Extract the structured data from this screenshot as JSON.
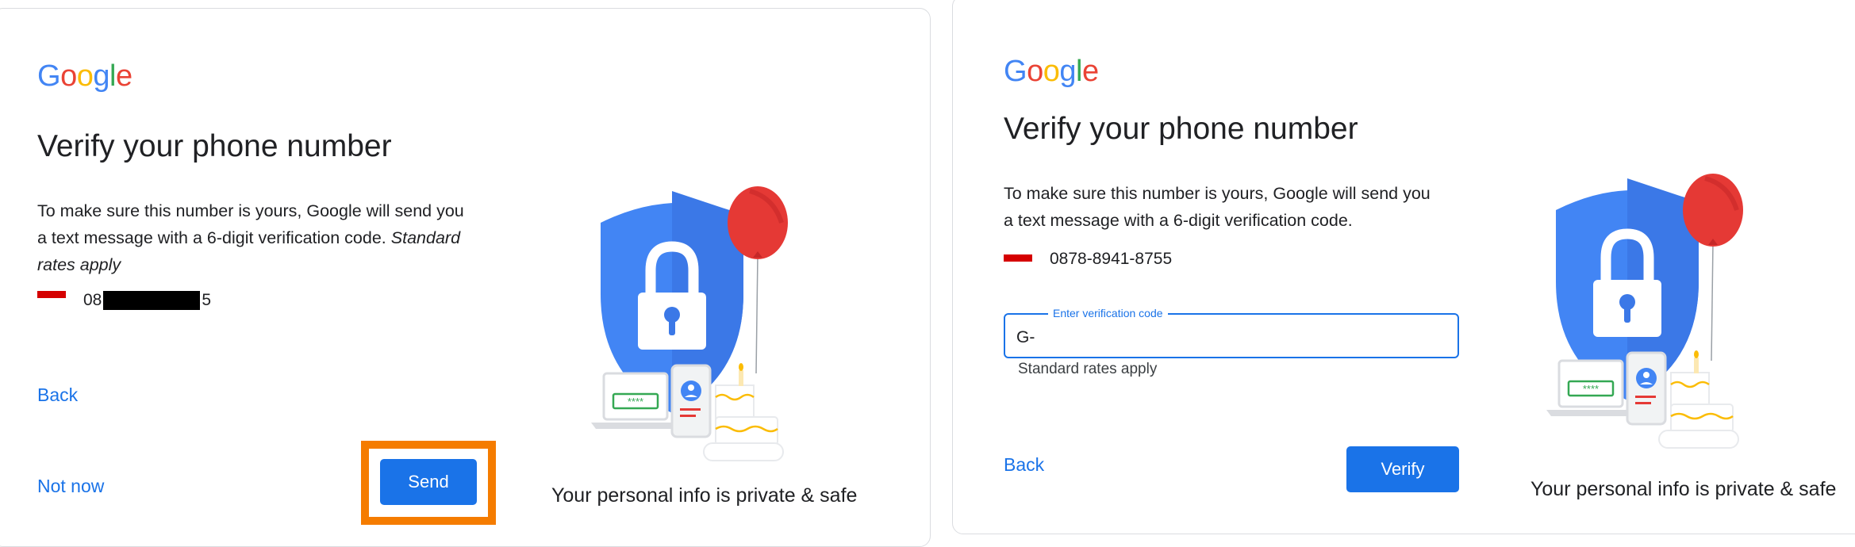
{
  "logo": {
    "letters": [
      {
        "char": "G",
        "color": "#4285F4"
      },
      {
        "char": "o",
        "color": "#EA4335"
      },
      {
        "char": "o",
        "color": "#FBBC05"
      },
      {
        "char": "g",
        "color": "#4285F4"
      },
      {
        "char": "l",
        "color": "#34A853"
      },
      {
        "char": "e",
        "color": "#EA4335"
      }
    ]
  },
  "left": {
    "title": "Verify your phone number",
    "description_line1": "To make sure this number is yours, Google will send you",
    "description_line2": "a text message with a 6-digit verification code.",
    "description_italic_a": "Standard",
    "description_italic_b": "rates apply",
    "phone_prefix": "08",
    "phone_suffix": "5",
    "back_label": "Back",
    "not_now_label": "Not now",
    "send_label": "Send",
    "privacy_text": "Your personal info is private & safe"
  },
  "right": {
    "title": "Verify your phone number",
    "description_line1": "To make sure this number is yours, Google will send you",
    "description_line2": "a text message with a 6-digit verification code.",
    "phone_number": "0878-8941-8755",
    "code_field_label": "Enter verification code",
    "code_field_value": "G-",
    "helper_text": "Standard rates apply",
    "back_label": "Back",
    "verify_label": "Verify",
    "privacy_text": "Your personal info is private & safe"
  },
  "illustration": {
    "code_mask": "****"
  },
  "colors": {
    "accent": "#1a73e8",
    "highlight": "#f57c00",
    "flag_red": "#d50000",
    "shield": "#4285F4",
    "balloon": "#E53935"
  }
}
